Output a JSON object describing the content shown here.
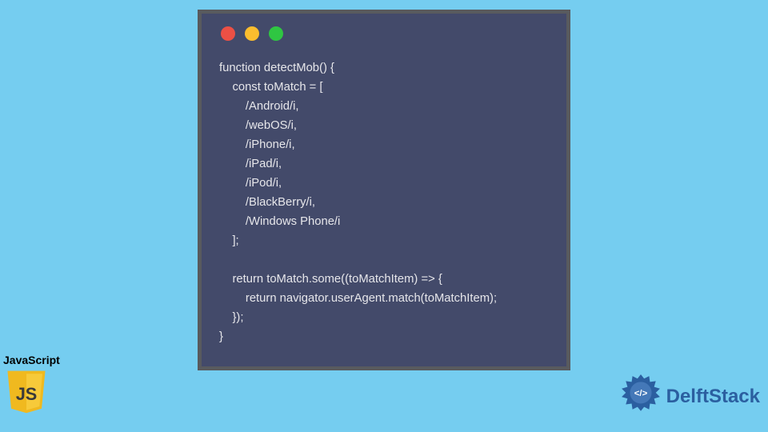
{
  "code_window": {
    "lines": [
      "function detectMob() {",
      "    const toMatch = [",
      "        /Android/i,",
      "        /webOS/i,",
      "        /iPhone/i,",
      "        /iPad/i,",
      "        /iPod/i,",
      "        /BlackBerry/i,",
      "        /Windows Phone/i",
      "    ];",
      " ",
      "    return toMatch.some((toMatchItem) => {",
      "        return navigator.userAgent.match(toMatchItem);",
      "    });",
      "}"
    ]
  },
  "js_badge": {
    "label": "JavaScript",
    "icon_text": "JS"
  },
  "delft": {
    "text": "DelftStack"
  },
  "colors": {
    "bg": "#75cdf0",
    "window_bg": "#434a6a",
    "window_border": "#585a5e",
    "tl_red": "#ec5045",
    "tl_yellow": "#fbbd2e",
    "tl_green": "#2fc642",
    "js_yellow": "#f0b91f",
    "delft_blue": "#2b5fa0"
  }
}
